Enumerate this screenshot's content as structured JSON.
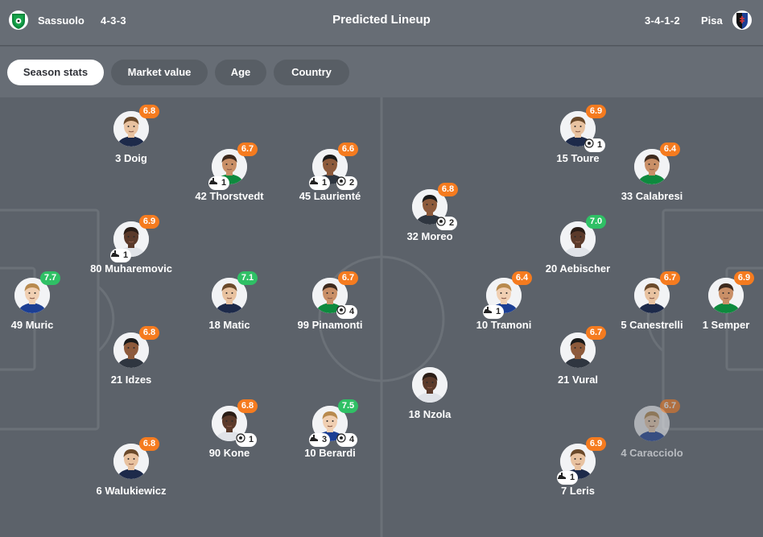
{
  "header": {
    "title": "Predicted Lineup",
    "home": {
      "name": "Sassuolo",
      "formation": "4-3-3",
      "logo": "sassuolo-logo",
      "color": "#0e8a3e"
    },
    "away": {
      "name": "Pisa",
      "formation": "3-4-1-2",
      "logo": "pisa-logo",
      "color": "#1c3f94"
    }
  },
  "tabs": [
    {
      "label": "Season stats",
      "active": true
    },
    {
      "label": "Market value",
      "active": false
    },
    {
      "label": "Age",
      "active": false
    },
    {
      "label": "Country",
      "active": false
    }
  ],
  "colors": {
    "rating_orange": "#f57b1f",
    "rating_green": "#2fc065"
  },
  "icons": {
    "assist": "boot-icon",
    "goal": "football-icon"
  },
  "home_players": [
    {
      "name": "3 Doig",
      "rating": "6.8",
      "rating_color": "orange",
      "stats": []
    },
    {
      "name": "42 Thorstvedt",
      "rating": "6.7",
      "rating_color": "orange",
      "stats": [
        {
          "icon": "assist",
          "count": "1"
        }
      ]
    },
    {
      "name": "45 Laurienté",
      "rating": "6.6",
      "rating_color": "orange",
      "stats": [
        {
          "icon": "assist",
          "count": "1"
        },
        {
          "icon": "goal",
          "count": "2"
        }
      ]
    },
    {
      "name": "80 Muharemovic",
      "rating": "6.9",
      "rating_color": "orange",
      "stats": [
        {
          "icon": "assist",
          "count": "1"
        }
      ]
    },
    {
      "name": "49 Muric",
      "rating": "7.7",
      "rating_color": "green",
      "stats": []
    },
    {
      "name": "18 Matic",
      "rating": "7.1",
      "rating_color": "green",
      "stats": []
    },
    {
      "name": "99 Pinamonti",
      "rating": "6.7",
      "rating_color": "orange",
      "stats": [
        {
          "icon": "goal",
          "count": "4"
        }
      ]
    },
    {
      "name": "21 Idzes",
      "rating": "6.8",
      "rating_color": "orange",
      "stats": []
    },
    {
      "name": "90 Kone",
      "rating": "6.8",
      "rating_color": "orange",
      "stats": [
        {
          "icon": "goal",
          "count": "1"
        }
      ]
    },
    {
      "name": "10 Berardi",
      "rating": "7.5",
      "rating_color": "green",
      "stats": [
        {
          "icon": "assist",
          "count": "3"
        },
        {
          "icon": "goal",
          "count": "4"
        }
      ]
    },
    {
      "name": "6 Walukiewicz",
      "rating": "6.8",
      "rating_color": "orange",
      "stats": []
    }
  ],
  "away_players": [
    {
      "name": "15 Toure",
      "rating": "6.9",
      "rating_color": "orange",
      "stats": [
        {
          "icon": "goal",
          "count": "1"
        }
      ]
    },
    {
      "name": "33 Calabresi",
      "rating": "6.4",
      "rating_color": "orange",
      "stats": []
    },
    {
      "name": "32 Moreo",
      "rating": "6.8",
      "rating_color": "orange",
      "stats": [
        {
          "icon": "goal",
          "count": "2"
        }
      ]
    },
    {
      "name": "20 Aebischer",
      "rating": "7.0",
      "rating_color": "green",
      "stats": []
    },
    {
      "name": "10 Tramoni",
      "rating": "6.4",
      "rating_color": "orange",
      "stats": [
        {
          "icon": "assist",
          "count": "1"
        }
      ]
    },
    {
      "name": "5 Canestrelli",
      "rating": "6.7",
      "rating_color": "orange",
      "stats": []
    },
    {
      "name": "1 Semper",
      "rating": "6.9",
      "rating_color": "orange",
      "stats": []
    },
    {
      "name": "21 Vural",
      "rating": "6.7",
      "rating_color": "orange",
      "stats": []
    },
    {
      "name": "18 Nzola",
      "rating": "",
      "rating_color": "",
      "stats": []
    },
    {
      "name": "4 Caracciolo",
      "rating": "6.7",
      "rating_color": "orange",
      "stats": [],
      "dim": true
    },
    {
      "name": "7 Leris",
      "rating": "6.9",
      "rating_color": "orange",
      "stats": [
        {
          "icon": "assist",
          "count": "1"
        }
      ]
    }
  ]
}
